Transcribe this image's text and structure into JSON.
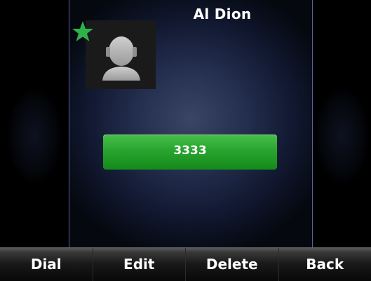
{
  "contact": {
    "name": "Al Dion",
    "number": "3333",
    "favorite_icon": "star-icon",
    "avatar_icon": "person-silhouette-icon"
  },
  "softkeys": [
    {
      "label": "Dial"
    },
    {
      "label": "Edit"
    },
    {
      "label": "Delete"
    },
    {
      "label": "Back"
    }
  ],
  "colors": {
    "favorite_star": "#2db34a",
    "number_button": "#2aa430",
    "divider": "#5a5f9a"
  }
}
